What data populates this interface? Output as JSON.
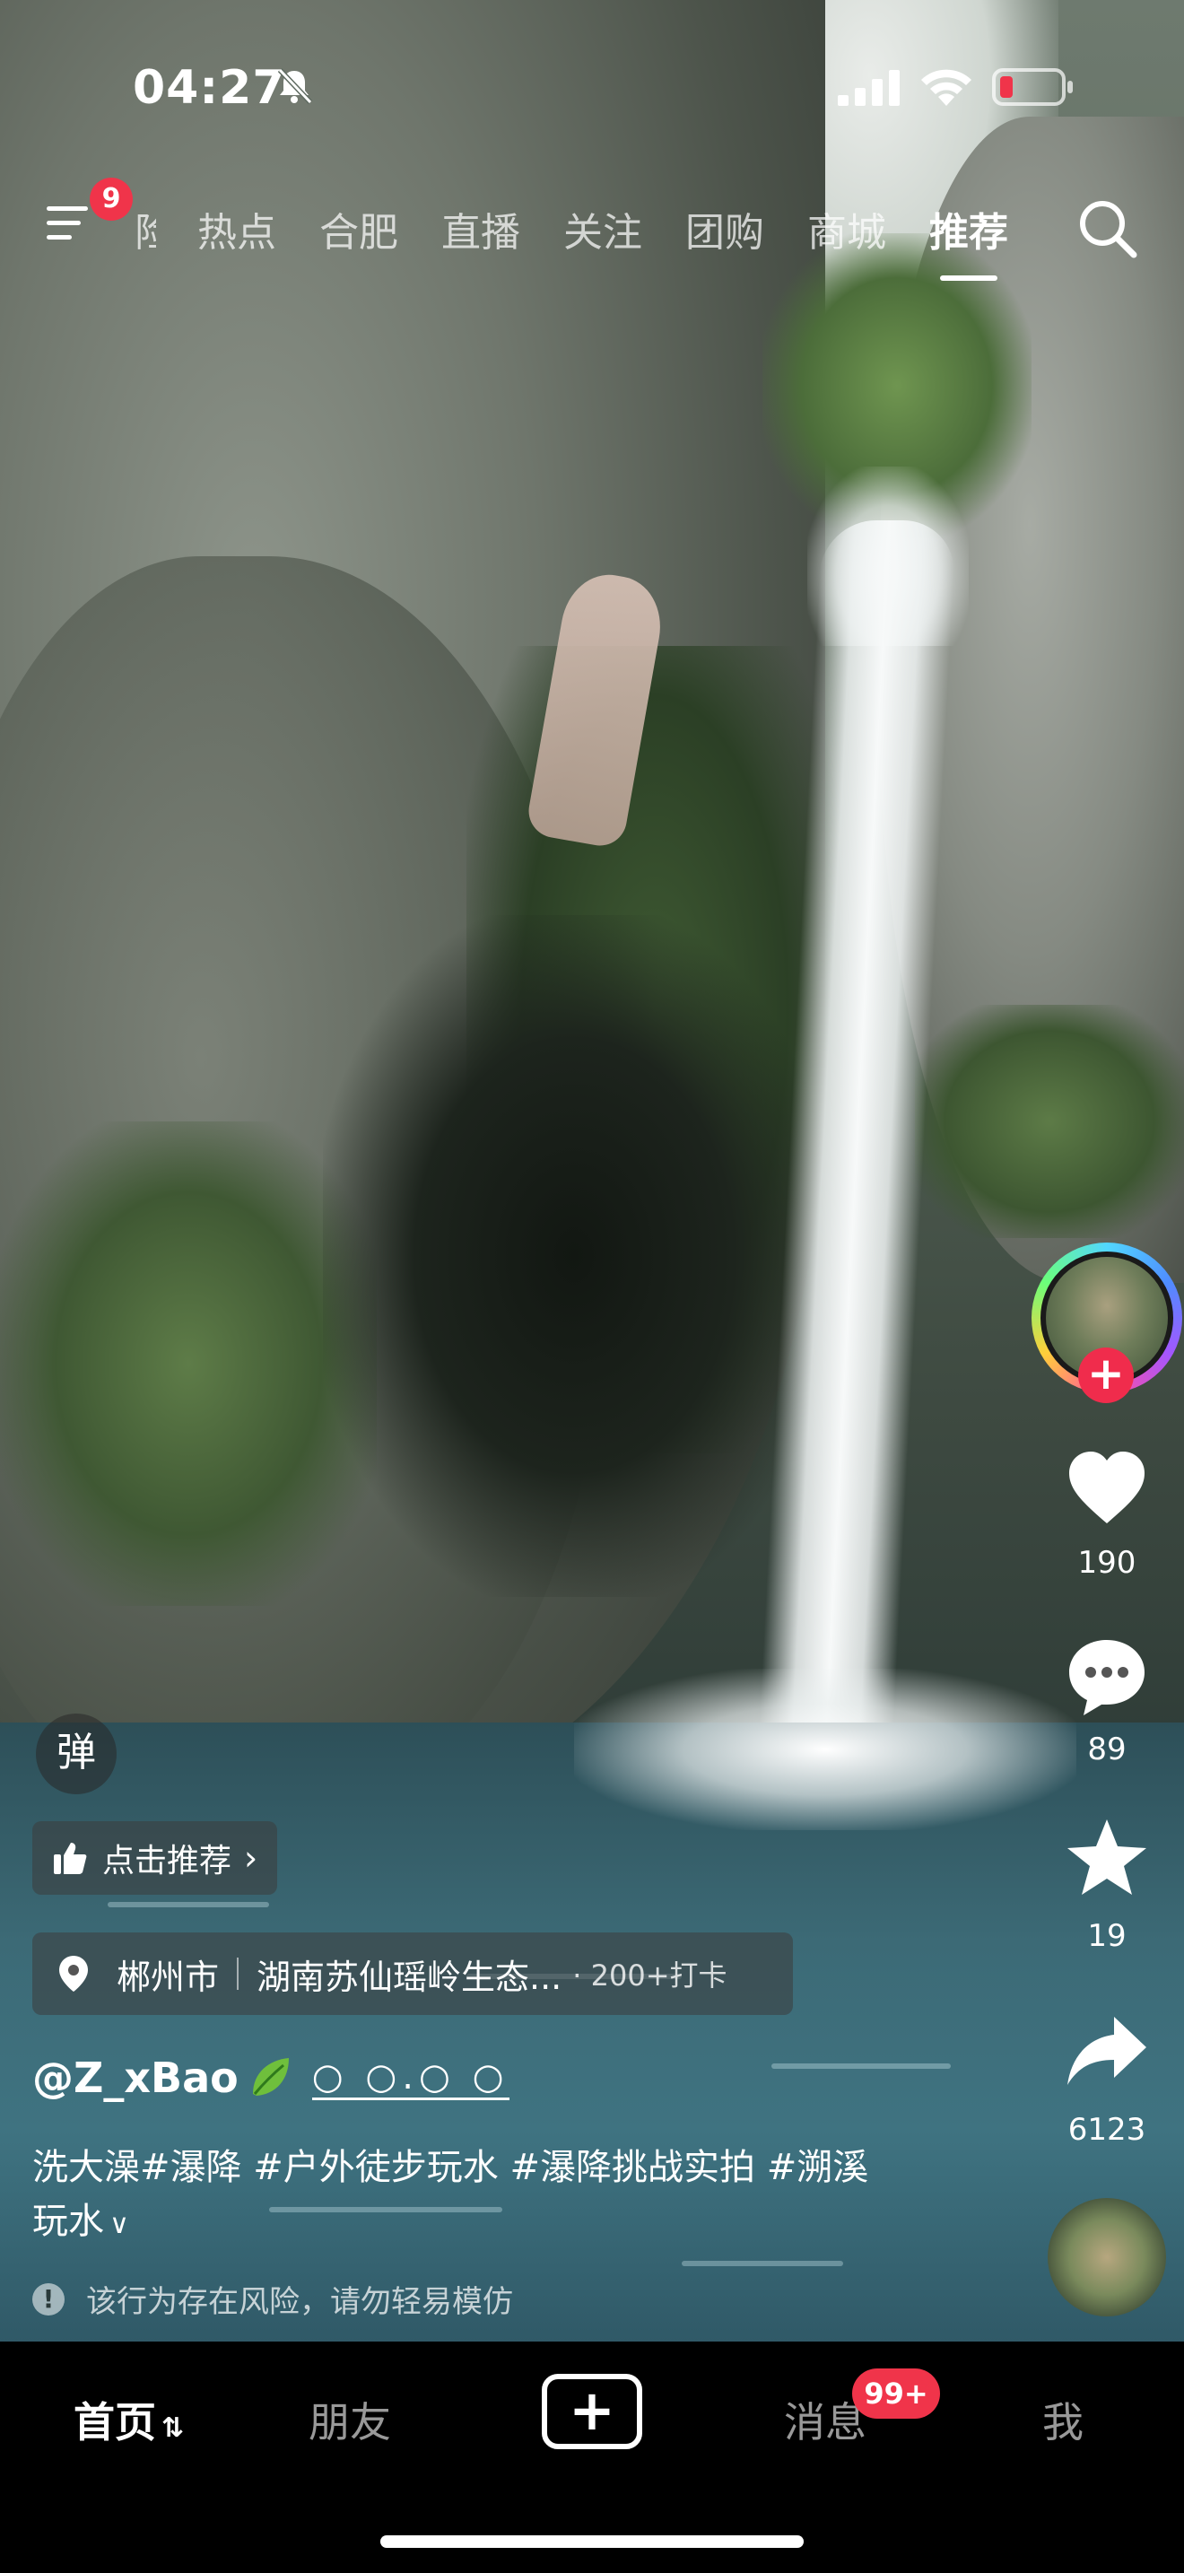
{
  "status": {
    "time": "04:27"
  },
  "nav": {
    "menu_badge": "9",
    "tabs": [
      {
        "label": "险"
      },
      {
        "label": "热点"
      },
      {
        "label": "合肥"
      },
      {
        "label": "直播"
      },
      {
        "label": "关注"
      },
      {
        "label": "团购"
      },
      {
        "label": "商城"
      },
      {
        "label": "推荐"
      }
    ],
    "active_tab": "推荐"
  },
  "rail": {
    "follow_symbol": "+",
    "likes": "190",
    "comments": "89",
    "favorites": "19",
    "shares": "6123"
  },
  "overlay": {
    "danmu": "弹",
    "recommend": "点击推荐",
    "location": {
      "city": "郴州市",
      "place": "湖南苏仙瑶岭生态...",
      "checkins": "· 200+打卡"
    },
    "author": "@Z_xBao",
    "author_deco": "○ ○.○ ○",
    "caption_line1": "洗大澡#瀑降 #户外徒步玩水 #瀑降挑战实拍 #溯溪",
    "caption_line2": "玩水",
    "warning": "该行为存在风险，请勿轻易模仿"
  },
  "tabbar": {
    "home": "首页",
    "friends": "朋友",
    "create": "+",
    "inbox": "消息",
    "inbox_badge": "99+",
    "me": "我"
  },
  "colors": {
    "accent_red": "#f0344a",
    "follow_red": "#f02c4c",
    "tabbar_bg": "#000000"
  }
}
